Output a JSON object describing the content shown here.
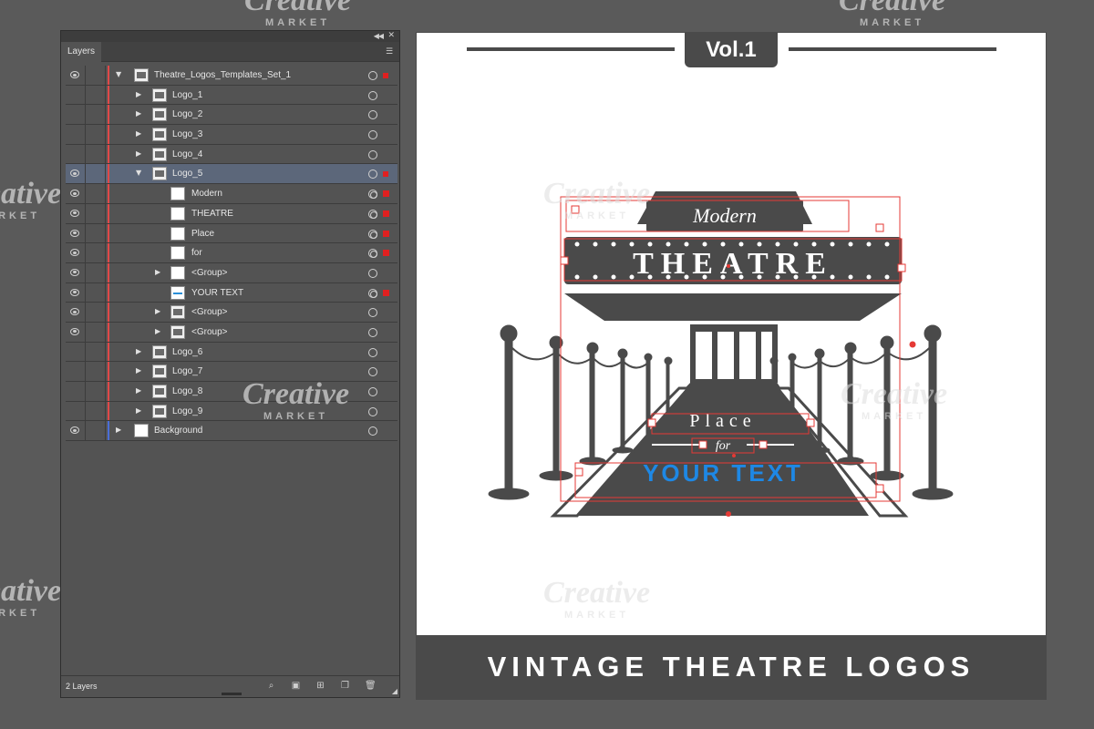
{
  "panel": {
    "title": "Layers",
    "layer_count": "2 Layers"
  },
  "layers": [
    {
      "name": "Theatre_Logos_Templates_Set_1"
    },
    {
      "name": "Logo_1"
    },
    {
      "name": "Logo_2"
    },
    {
      "name": "Logo_3"
    },
    {
      "name": "Logo_4"
    },
    {
      "name": "Logo_5"
    },
    {
      "name": "Modern"
    },
    {
      "name": "THEATRE"
    },
    {
      "name": "Place"
    },
    {
      "name": "for"
    },
    {
      "name": "<Group>"
    },
    {
      "name": "YOUR TEXT"
    },
    {
      "name": "<Group>"
    },
    {
      "name": "<Group>"
    },
    {
      "name": "Logo_6"
    },
    {
      "name": "Logo_7"
    },
    {
      "name": "Logo_8"
    },
    {
      "name": "Logo_9"
    },
    {
      "name": "Background"
    }
  ],
  "document": {
    "volume": "Vol.1",
    "footer": "VINTAGE THEATRE LOGOS",
    "logo": {
      "top_word": "Modern",
      "main_word": "THEATRE",
      "place_word": "Place",
      "for_word": "for",
      "custom_text": "YOUR TEXT"
    }
  },
  "watermark": {
    "brand": "Creative",
    "sub": "MARKET"
  },
  "colors": {
    "selection": "#e53935",
    "accent_text": "#1e88e5",
    "dark": "#4a4a4a"
  }
}
